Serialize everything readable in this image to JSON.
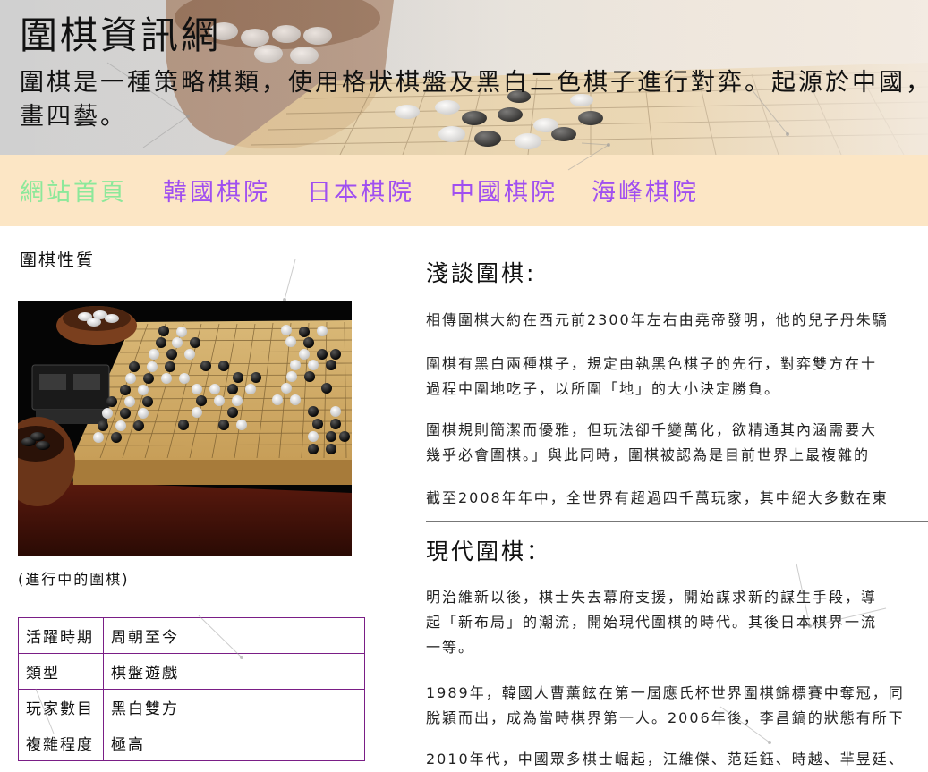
{
  "header": {
    "title": "圍棋資訊網",
    "description_line1": "圍棋是一種策略棋類，使用格狀棋盤及黑白二色棋子進行對弈。起源於中國，",
    "description_line2": "畫四藝。"
  },
  "nav": {
    "items": [
      {
        "label": "網站首頁",
        "current": true
      },
      {
        "label": "韓國棋院",
        "current": false
      },
      {
        "label": "日本棋院",
        "current": false
      },
      {
        "label": "中國棋院",
        "current": false
      },
      {
        "label": "海峰棋院",
        "current": false
      }
    ]
  },
  "sidebar": {
    "title": "圍棋性質",
    "image_caption": "(進行中的圍棋)",
    "info_rows": [
      {
        "key": "活躍時期",
        "value": "周朝至今"
      },
      {
        "key": "類型",
        "value": "棋盤遊戲"
      },
      {
        "key": "玩家數目",
        "value": "黑白雙方"
      },
      {
        "key": "複雜程度",
        "value": "極高"
      }
    ]
  },
  "main": {
    "section1": {
      "title": "淺談圍棋:",
      "paragraphs": [
        [
          "相傳圍棋大約在西元前2300年左右由堯帝發明，他的兒子丹朱驕"
        ],
        [
          "圍棋有黑白兩種棋子，規定由執黑色棋子的先行，對弈雙方在十",
          "過程中圍地吃子，以所圍「地」的大小決定勝負。"
        ],
        [
          "圍棋規則簡潔而優雅，但玩法卻千變萬化，欲精通其內涵需要大",
          "幾乎必會圍棋。」與此同時，圍棋被認為是目前世界上最複雜的"
        ],
        [
          "截至2008年年中，全世界有超過四千萬玩家，其中絕大多數在東"
        ]
      ]
    },
    "section2": {
      "title": "現代圍棋：",
      "paragraphs": [
        [
          "明治維新以後，棋士失去幕府支援，開始謀求新的謀生手段，導",
          "起「新布局」的潮流，開始現代圍棋的時代。其後日本棋界一流",
          "一等。"
        ],
        [
          "1989年，韓國人曹薰鉉在第一屆應氏杯世界圍棋錦標賽中奪冠，同",
          "脫穎而出，成為當時棋界第一人。2006年後，李昌鎬的狀態有所下"
        ],
        [
          "2010年代，中國眾多棋士崛起，江維傑、范廷鈺、時越、羋昱廷、"
        ]
      ]
    }
  },
  "colors": {
    "nav_background": "#fce6c5",
    "nav_link": "#a04ff0",
    "nav_current": "#8ce89a",
    "table_border": "#7a1e86"
  }
}
